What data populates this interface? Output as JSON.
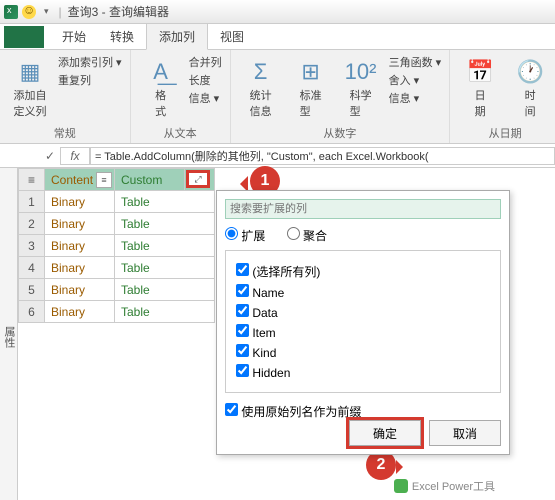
{
  "titlebar": {
    "title": "查询3 - 查询编辑器",
    "sep": "|",
    "dropdown_glyph": "▾"
  },
  "file_button": "",
  "tabs": {
    "home": "开始",
    "transform": "转换",
    "addcol": "添加列",
    "view": "视图"
  },
  "ribbon": {
    "group1": {
      "bigbtn": "添加自\n定义列",
      "s1": "添加索引列 ▾",
      "s2": "重复列",
      "label": "常规",
      "icon": "▦"
    },
    "group2": {
      "bigbtn": "格\n式",
      "s1": "合并列",
      "s2": "长度",
      "s3": "信息 ▾",
      "label": "从文本",
      "icon1": "A͟",
      "icon2": "ᴬᴮᶜ",
      "icon3": "ᴬᴮᶜ"
    },
    "group3": {
      "b1": "统计\n信息",
      "b2": "标准\n型",
      "b3": "科学\n型",
      "s1": "三角函数 ▾",
      "s2": "舍入 ▾",
      "s3": "信息 ▾",
      "label": "从数字",
      "icon1": "Σ",
      "icon2": "⊞",
      "icon3": "10²"
    },
    "group4": {
      "b1": "日\n期",
      "b2": "时\n间",
      "label": "从日期",
      "icon1": "📅",
      "icon2": "🕐"
    }
  },
  "formula": {
    "fx": "fx",
    "check": "✓",
    "value": "= Table.AddColumn(删除的其他列, \"Custom\", each Excel.Workbook("
  },
  "side": "属性",
  "headers": {
    "row": "",
    "content": "Content",
    "custom": "Custom",
    "type_glyph": "≡",
    "expand_glyph": "⤢"
  },
  "rows": [
    {
      "n": "1",
      "content": "Binary",
      "custom": "Table"
    },
    {
      "n": "2",
      "content": "Binary",
      "custom": "Table"
    },
    {
      "n": "3",
      "content": "Binary",
      "custom": "Table"
    },
    {
      "n": "4",
      "content": "Binary",
      "custom": "Table"
    },
    {
      "n": "5",
      "content": "Binary",
      "custom": "Table"
    },
    {
      "n": "6",
      "content": "Binary",
      "custom": "Table"
    }
  ],
  "popup": {
    "search_placeholder": "搜索要扩展的列",
    "radio_expand": "扩展",
    "radio_agg": "聚合",
    "chk_all": "(选择所有列)",
    "cols": [
      "Name",
      "Data",
      "Item",
      "Kind",
      "Hidden"
    ],
    "prefix": "使用原始列名作为前缀",
    "ok": "确定",
    "cancel": "取消"
  },
  "callouts": {
    "one": "1",
    "two": "2"
  },
  "watermark": "Excel Power工具"
}
